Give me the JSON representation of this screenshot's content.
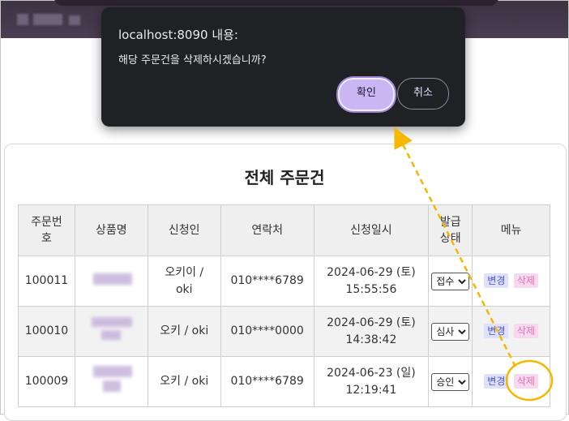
{
  "dialog": {
    "title": "localhost:8090 내용:",
    "message": "해당 주문건을 삭제하시겠습니까?",
    "confirm_label": "확인",
    "cancel_label": "취소"
  },
  "page": {
    "title": "전체 주문건"
  },
  "table": {
    "headers": [
      "주문번호",
      "상품명",
      "신청인",
      "연락처",
      "신청일시",
      "발급상태",
      "메뉴"
    ],
    "rows": [
      {
        "order_no": "100011",
        "applicant": "오키이 / oki",
        "contact": "010****6789",
        "date": "2024-06-29 (토)",
        "time": "15:55:56",
        "status": "접수"
      },
      {
        "order_no": "100010",
        "applicant": "오키 / oki",
        "contact": "010****0000",
        "date": "2024-06-29 (토)",
        "time": "14:38:42",
        "status": "심사"
      },
      {
        "order_no": "100009",
        "applicant": "오키 / oki",
        "contact": "010****6789",
        "date": "2024-06-23 (일)",
        "time": "12:19:41",
        "status": "승인"
      }
    ],
    "edit_label": "변경",
    "delete_label": "삭제"
  },
  "colors": {
    "annotation": "#f5b800",
    "dialog_bg": "#202124",
    "confirm_bg": "#c9b6f2"
  }
}
